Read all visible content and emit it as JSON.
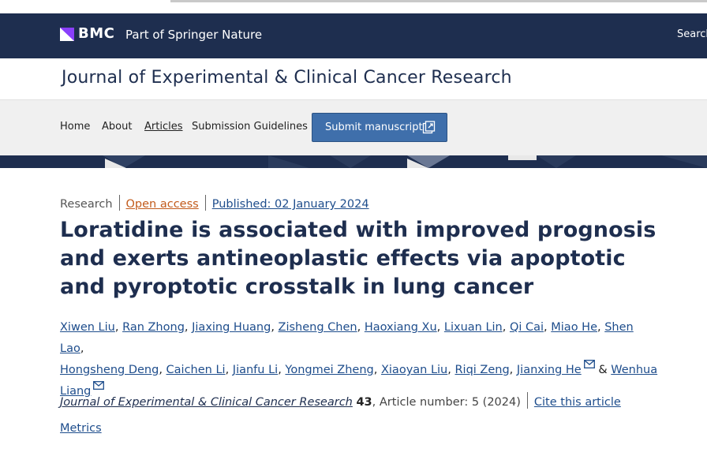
{
  "brand": {
    "logo_text": "BMC",
    "subtitle": "Part of Springer Nature",
    "search_label": "Search",
    "colors": {
      "header_bg": "#1e2e4f",
      "logo_accent": "#8a3ffc",
      "link": "#1e4d8c",
      "open_access": "#c25b1c",
      "button": "#3f6fab"
    }
  },
  "journal": {
    "title": "Journal of Experimental & Clinical Cancer Research"
  },
  "nav": {
    "items": [
      {
        "label": "Home"
      },
      {
        "label": "About"
      },
      {
        "label": "Articles"
      },
      {
        "label": "Submission Guidelines"
      }
    ],
    "submit_label": "Submit manuscript",
    "submit_icon": "external-link-icon"
  },
  "article": {
    "type": "Research",
    "access": "Open access",
    "published": "Published: 02 January 2024",
    "title": "Loratidine is associated with improved prognosis and exerts antineoplastic effects via apoptotic and pyroptotic crosstalk in lung cancer",
    "authors": [
      "Xiwen Liu",
      "Ran Zhong",
      "Jiaxing Huang",
      "Zisheng Chen",
      "Haoxiang Xu",
      "Lixuan Lin",
      "Qi Cai",
      "Miao He",
      "Shen Lao",
      "Hongsheng Deng",
      "Caichen Li",
      "Jianfu Li",
      "Yongmei Zheng",
      "Xiaoyan Liu",
      "Riqi Zeng",
      "Jianxing He",
      "Wenhua Liang"
    ],
    "author_separator": ", ",
    "author_and": " & ",
    "corresponding_icon": "mail-icon",
    "citation": {
      "journal": "Journal of Experimental & Clinical Cancer Research",
      "volume": "43",
      "details": ", Article number: 5 (2024)",
      "cite_label": "Cite this article"
    },
    "metrics_label": "Metrics"
  }
}
